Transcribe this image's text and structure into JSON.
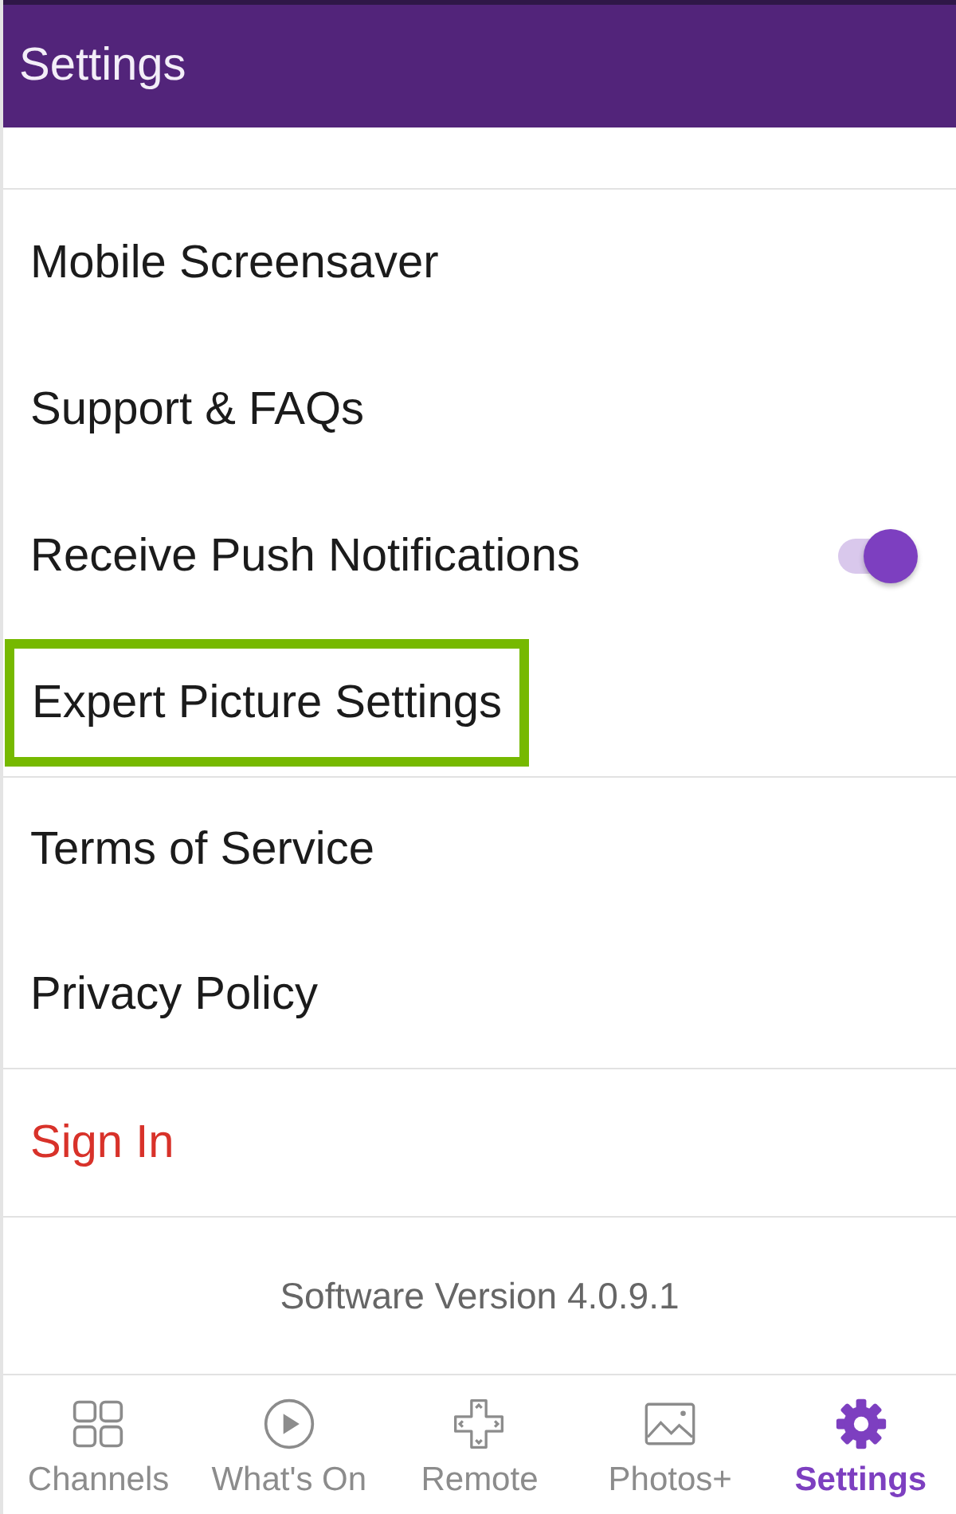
{
  "app_bar": {
    "title": "Settings"
  },
  "groups": [
    {
      "items": [
        {
          "label": "Mobile Screensaver",
          "kind": "link",
          "highlighted": false
        },
        {
          "label": "Support & FAQs",
          "kind": "link",
          "highlighted": false
        },
        {
          "label": "Receive Push Notifications",
          "kind": "toggle",
          "on": true,
          "highlighted": false
        },
        {
          "label": "Expert Picture Settings",
          "kind": "link",
          "highlighted": true
        }
      ]
    },
    {
      "items": [
        {
          "label": "Terms of Service",
          "kind": "link",
          "highlighted": false
        },
        {
          "label": "Privacy Policy",
          "kind": "link",
          "highlighted": false
        }
      ]
    },
    {
      "items": [
        {
          "label": "Sign In",
          "kind": "accent",
          "highlighted": false
        }
      ]
    }
  ],
  "version": "Software Version 4.0.9.1",
  "nav": [
    {
      "label": "Channels",
      "kind": "grid",
      "selected": false
    },
    {
      "label": "What's On",
      "kind": "play",
      "selected": false
    },
    {
      "label": "Remote",
      "kind": "dpad",
      "selected": false
    },
    {
      "label": "Photos+",
      "kind": "image",
      "selected": false
    },
    {
      "label": "Settings",
      "kind": "gear",
      "selected": true
    }
  ]
}
